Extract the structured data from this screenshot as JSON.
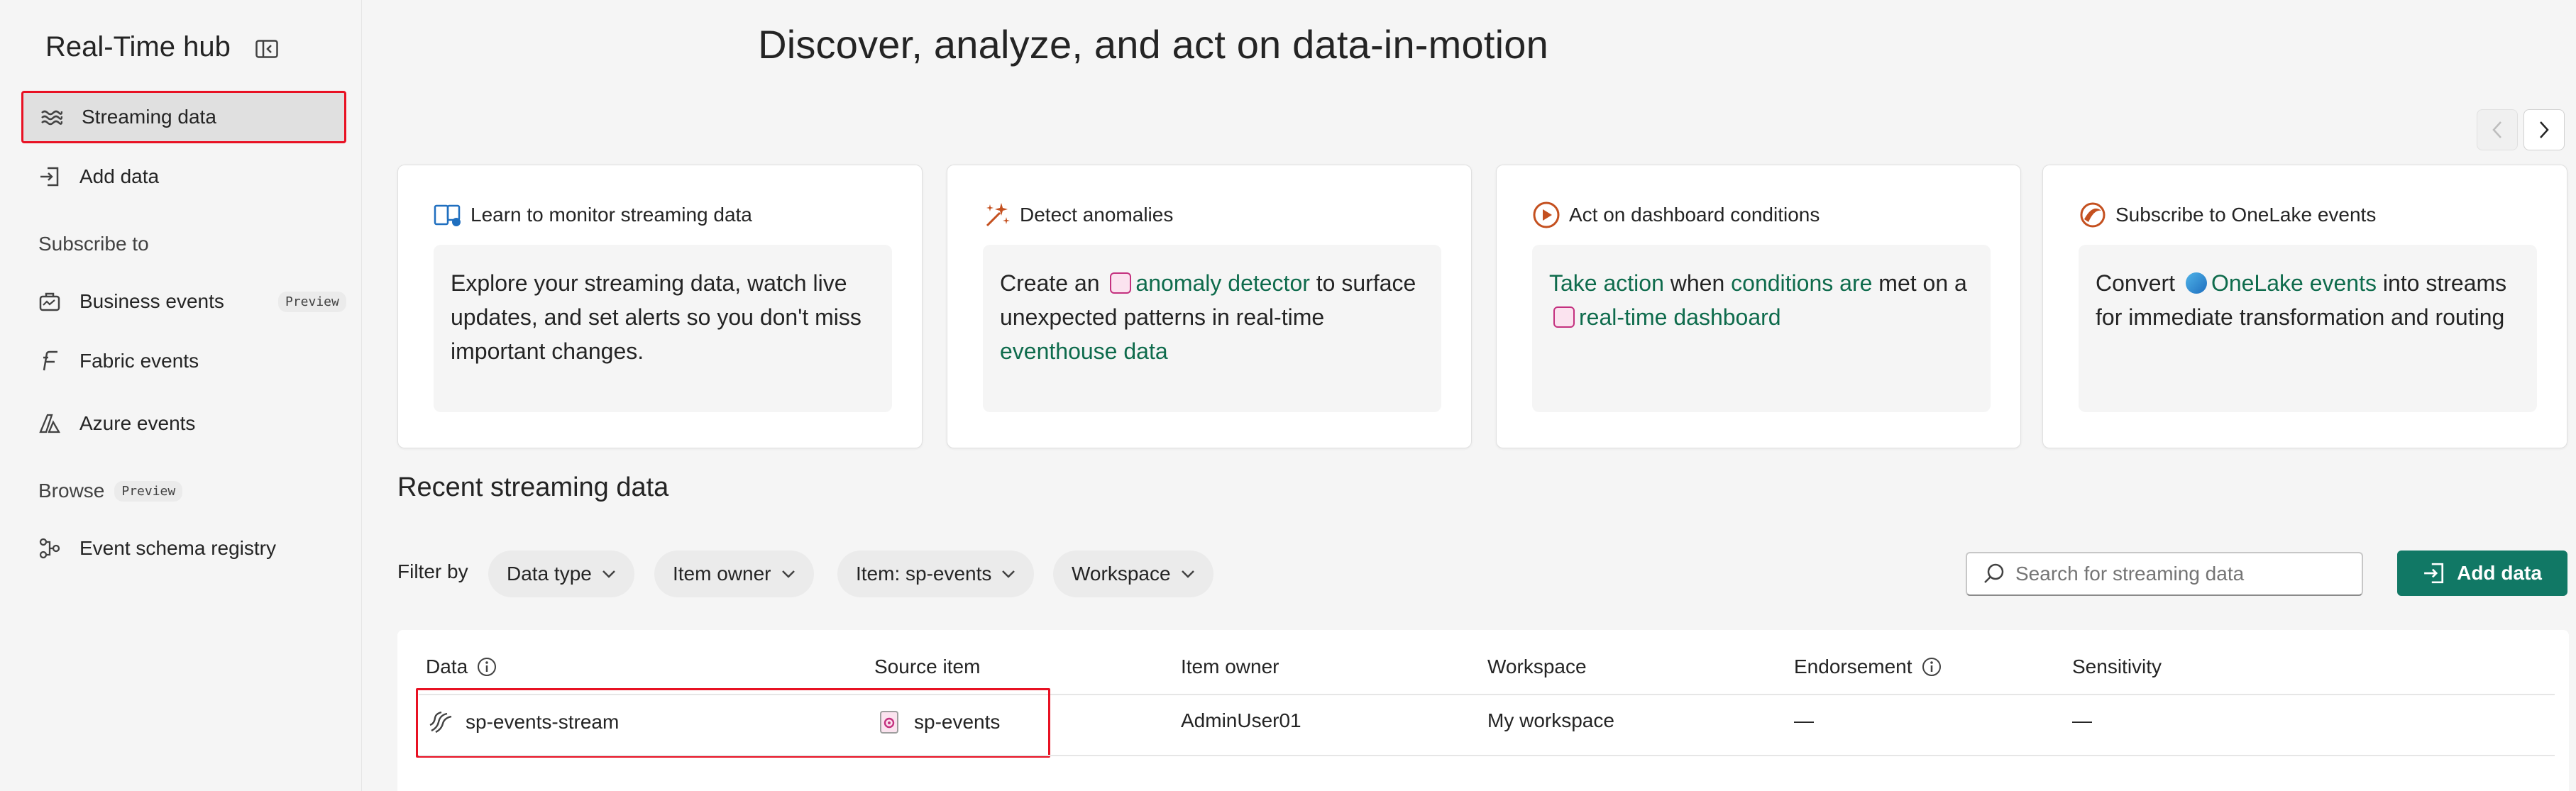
{
  "sidebar": {
    "title": "Real-Time hub",
    "items": [
      {
        "label": "Streaming data",
        "icon": "streaming-data-icon"
      },
      {
        "label": "Add data",
        "icon": "add-data-icon"
      }
    ],
    "subscribe_heading": "Subscribe to",
    "subscribe_items": [
      {
        "label": "Business events",
        "icon": "business-events-icon",
        "badge": "Preview"
      },
      {
        "label": "Fabric events",
        "icon": "fabric-events-icon"
      },
      {
        "label": "Azure events",
        "icon": "azure-events-icon"
      }
    ],
    "browse_heading": "Browse",
    "browse_badge": "Preview",
    "browse_items": [
      {
        "label": "Event schema registry",
        "icon": "schema-registry-icon"
      }
    ]
  },
  "header": {
    "title": "Discover, analyze, and act on data-in-motion"
  },
  "cards": [
    {
      "title": "Learn to monitor streaming data",
      "icon": "monitor-icon",
      "body": "Explore your streaming data, watch live updates, and set alerts so you don't miss important changes."
    },
    {
      "title": "Detect anomalies",
      "icon": "sparkle-icon",
      "pre": "Create an",
      "link1": "anomaly detector",
      "mid": "to surface unexpected patterns in real-time",
      "link2": "eventhouse data"
    },
    {
      "title": "Act on dashboard conditions",
      "icon": "play-circle-icon",
      "link1": "Take action",
      "mid1": "when",
      "link2": "conditions are",
      "mid2": "met on a",
      "link3": "real-time dashboard"
    },
    {
      "title": "Subscribe to OneLake events",
      "icon": "onelake-icon",
      "pre": "Convert",
      "link1": "OneLake events",
      "post": "into streams for immediate transformation and routing"
    }
  ],
  "recent": {
    "title": "Recent streaming data",
    "filter_label": "Filter by",
    "filters": [
      "Data type",
      "Item owner",
      "Item: sp-events",
      "Workspace"
    ],
    "search_placeholder": "Search for streaming data",
    "add_button": "Add data"
  },
  "table": {
    "columns": [
      "Data",
      "Source item",
      "Item owner",
      "Workspace",
      "Endorsement",
      "Sensitivity"
    ],
    "rows": [
      {
        "data": "sp-events-stream",
        "source_item": "sp-events",
        "item_owner": "AdminUser01",
        "workspace": "My workspace",
        "endorsement": "—",
        "sensitivity": "—"
      }
    ]
  },
  "colors": {
    "accent": "#117865",
    "link": "#0e6b4c",
    "highlight_border": "#e81123"
  }
}
